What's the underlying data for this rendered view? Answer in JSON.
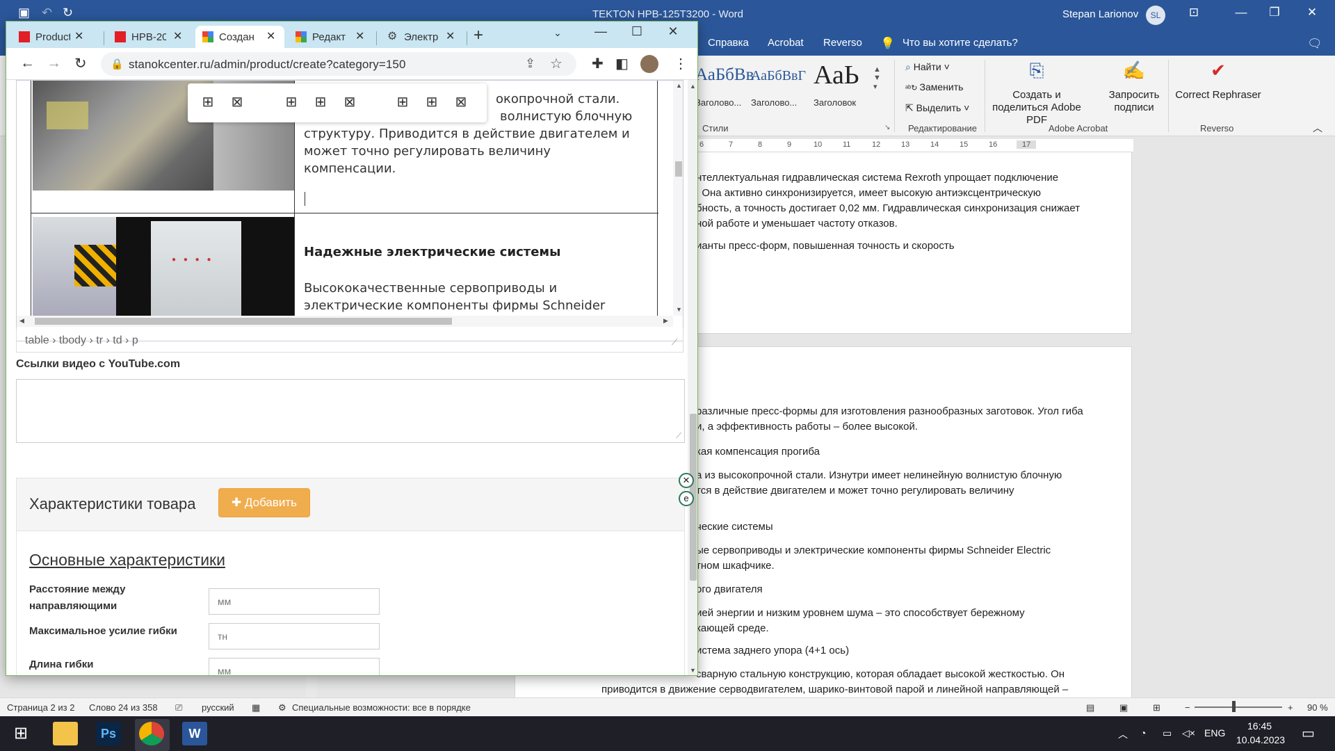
{
  "word": {
    "title": "TEKTON HPB-125T3200  -  Word",
    "user": "Stepan Larionov",
    "user_initials": "SL",
    "menu": [
      "Справка",
      "Acrobat",
      "Reverso"
    ],
    "tellme": "Что вы хотите сделать?",
    "styles": [
      {
        "sample": "АаБбВв",
        "label": "Заголово..."
      },
      {
        "sample": "АаБбВвГ",
        "label": "Заголово..."
      },
      {
        "sample": "АаЬ",
        "label": "Заголовок"
      }
    ],
    "styles_group": "Стили",
    "edit_items": [
      "Найти",
      "Заменить",
      "Выделить"
    ],
    "edit_group": "Редактирование",
    "acrobat_buttons": [
      "Создать и поделиться Adobe PDF",
      "Запросить подписи"
    ],
    "acrobat_group": "Adobe Acrobat",
    "reverso_button": "Correct Rephraser",
    "reverso_group": "Reverso",
    "ruler": [
      "6",
      "7",
      "8",
      "9",
      "10",
      "11",
      "12",
      "13",
      "14",
      "15",
      "16",
      "17"
    ],
    "page1_lines": [
      "нтеллектуальная гидравлическая система Rexroth упрощает подключение",
      ". Она активно синхронизируется, имеет высокую антиэксцентрическую",
      "бность, а точность достигает 0,02 мм. Гидравлическая синхронизация снижает",
      "ной работе и уменьшает частоту отказов.",
      "ианты пресс-форм, повышенная точность и скорость"
    ],
    "page2_lines": [
      "различные пресс-формы для изготовления разнообразных заготовок. Угол гиба",
      "и, а эффективность работы – более высокой.",
      "кая компенсация прогиба",
      "а из высокопрочной стали. Изнутри имеет нелинейную волнистую блочную",
      "тся в действие двигателем и может точно регулировать величину",
      "ческие системы",
      "ые сервоприводы и электрические компоненты фирмы Schneider Electric",
      "тном шкафчике.",
      "ого двигателя",
      "ией энергии и низким уровнем шума – это способствует бережному",
      "кающей среде.",
      "истема заднего упора (4+1 ось)",
      "сварную стальную конструкцию, которая обладает высокой жесткостью. Он",
      "приводится в движение серводвигателем, шарико-винтовой парой и линейной направляющей –"
    ],
    "status": {
      "page": "Страница 2 из 2",
      "words": "Слово 24 из 358",
      "lang": "русский",
      "access": "Специальные возможности: все в порядке",
      "zoom": "90 %"
    }
  },
  "chrome": {
    "tabs": [
      {
        "label": "Product",
        "favicon": "red-l"
      },
      {
        "label": "HPB-20",
        "favicon": "red-l"
      },
      {
        "label": "Создан",
        "favicon": "google-multi",
        "active": true
      },
      {
        "label": "Редакт",
        "favicon": "google-multi"
      },
      {
        "label": "Электр",
        "favicon": "gear"
      }
    ],
    "url": "stanokcenter.ru/admin/product/create?category=150"
  },
  "editor": {
    "cell1_lines": [
      "окопрочной стали.",
      "волнистую блочную",
      "структуру. Приводится в действие двигателем и",
      "может точно регулировать величину",
      "компенсации."
    ],
    "cell2_title": "Надежные электрические системы",
    "cell2_lines": [
      "Высококачественные сервоприводы и",
      "электрические компоненты фирмы Schneider"
    ],
    "path": "table › tbody › tr › td › p"
  },
  "form": {
    "youtube_label": "Ссылки видео с YouTube.com",
    "panel_title": "Характеристики товара",
    "add_button": "Добавить",
    "section_title": "Основные характеристики",
    "fields": [
      {
        "label": "Расстояние между направляющими",
        "placeholder": "мм"
      },
      {
        "label": "Максимальное усилие гибки",
        "placeholder": "тн"
      },
      {
        "label": "Длина гибки",
        "placeholder": "мм"
      }
    ]
  },
  "taskbar": {
    "lang": "ENG",
    "time": "16:45",
    "date": "10.04.2023"
  },
  "colors": {
    "word_blue": "#2b579a",
    "chrome_tabstrip": "#c9e6f2",
    "add_button": "#f0ad4e"
  }
}
